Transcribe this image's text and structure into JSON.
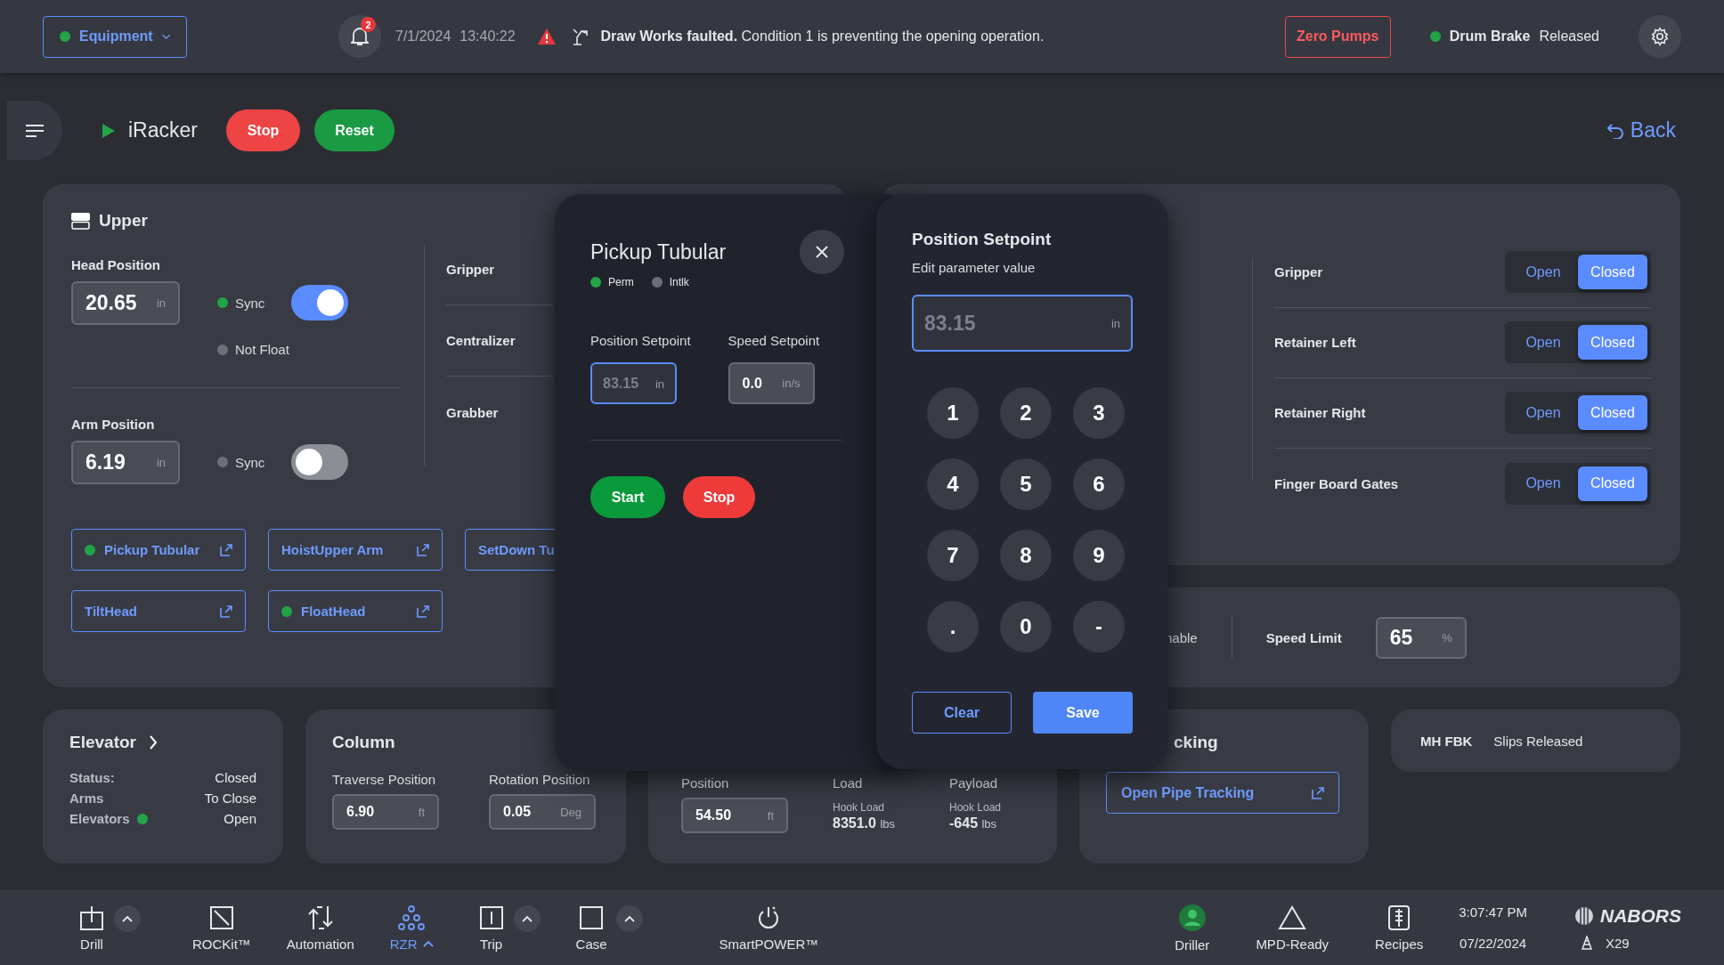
{
  "top_bar": {
    "equipment": {
      "label": "Equipment",
      "active": true
    },
    "notifications": "2",
    "date": "7/1/2024",
    "time": "13:40:22",
    "alert": "**Draw Works faulted.** Condition 1 is preventing the opening operation.",
    "zero_pumps": "Zero Pumps",
    "drum_brake": {
      "label": "Drum Brake",
      "value": "Released",
      "active": true
    }
  },
  "header": {
    "title": "iRacker",
    "running": true,
    "buttons": [
      {
        "label": "Stop",
        "kind": "danger"
      },
      {
        "label": "Reset",
        "kind": "success"
      }
    ],
    "back": "Back"
  },
  "upper": {
    "title": "Upper",
    "positions": [
      {
        "label": "Head Position",
        "value": "20.65",
        "unit": "in",
        "sync": {
          "label": "Sync",
          "active": true,
          "on": true
        },
        "float": {
          "label": "Not Float",
          "active": false
        }
      },
      {
        "label": "Arm Position",
        "value": "6.19",
        "unit": "in",
        "sync": {
          "label": "Sync",
          "active": false,
          "on": false
        }
      }
    ],
    "devices": [
      "Gripper",
      "Centralizer",
      "Grabber"
    ],
    "functions": [
      {
        "label": "Pickup Tubular",
        "active": true
      },
      {
        "label": "HoistUpper Arm",
        "active": false
      },
      {
        "label": "SetDown Tu",
        "active": false
      },
      {
        "label": "TiltHead",
        "active": false
      },
      {
        "label": "FloatHead",
        "active": true
      }
    ]
  },
  "clamps": [
    {
      "label": "Gripper",
      "options": [
        {
          "label": "Open",
          "selected": false
        },
        {
          "label": "Closed",
          "selected": true
        }
      ]
    },
    {
      "label": "Retainer Left",
      "options": [
        {
          "label": "Open",
          "selected": false
        },
        {
          "label": "Closed",
          "selected": true
        }
      ]
    },
    {
      "label": "Retainer Right",
      "options": [
        {
          "label": "Open",
          "selected": false
        },
        {
          "label": "Closed",
          "selected": true
        }
      ]
    },
    {
      "label": "Finger Board Gates",
      "options": [
        {
          "label": "Open",
          "selected": false
        },
        {
          "label": "Closed",
          "selected": true
        }
      ]
    }
  ],
  "limits": {
    "enable": "nable",
    "speed_limit": {
      "label": "Speed Limit",
      "value": "65",
      "unit": "%"
    }
  },
  "elevator": {
    "title": "Elevator",
    "rows": [
      {
        "label": "Status:",
        "value": "Closed",
        "active": false
      },
      {
        "label": "Arms",
        "value": "To Close",
        "active": false
      },
      {
        "label": "Elevators",
        "value": "Open",
        "active": true
      }
    ]
  },
  "column": {
    "title": "Column",
    "fields": [
      {
        "label": "Traverse Position",
        "value": "6.90",
        "unit": "ft"
      },
      {
        "label": "Rotation Position",
        "value": "0.05",
        "unit": "Deg"
      }
    ]
  },
  "racker": {
    "position": {
      "label": "Position",
      "value": "54.50",
      "unit": "ft"
    },
    "readings": [
      {
        "label": "Load",
        "caption": "Hook Load",
        "value": "8351.0",
        "unit": "lbs"
      },
      {
        "label": "Payload",
        "caption": "Hook Load",
        "value": "-645",
        "unit": "lbs"
      }
    ]
  },
  "pipe_tracking": {
    "title": "cking",
    "button": "Open Pipe Tracking"
  },
  "mh_fbk": {
    "label": "MH FBK",
    "value": "Slips Released"
  },
  "pickup_dialog": {
    "title": "Pickup Tubular",
    "indicators": [
      {
        "label": "Perm",
        "active": true
      },
      {
        "label": "Intlk",
        "active": false
      }
    ],
    "fields": [
      {
        "label": "Position Setpoint",
        "placeholder": "83.15",
        "unit": "in",
        "focused": true
      },
      {
        "label": "Speed Setpoint",
        "value": "0.0",
        "unit": "in/s",
        "focused": false
      }
    ],
    "buttons": [
      {
        "label": "Start",
        "kind": "success"
      },
      {
        "label": "Stop",
        "kind": "danger"
      }
    ]
  },
  "keypad": {
    "title": "Position Setpoint",
    "subtitle": "Edit parameter value",
    "field": {
      "placeholder": "83.15",
      "unit": "in",
      "focused": true
    },
    "keys": [
      "1",
      "2",
      "3",
      "4",
      "5",
      "6",
      "7",
      "8",
      "9",
      ".",
      "0",
      "-"
    ],
    "buttons": [
      {
        "label": "Clear",
        "kind": "outline"
      },
      {
        "label": "Save",
        "kind": "primary"
      }
    ]
  },
  "bottom_nav": {
    "items": [
      {
        "label": "Drill",
        "kind": "drill",
        "expandable": true,
        "selected": false
      },
      {
        "label": "ROCKit™",
        "kind": "rockit",
        "expandable": false,
        "selected": false
      },
      {
        "label": "Automation",
        "kind": "automation",
        "expandable": false,
        "selected": false
      },
      {
        "label": "RZR",
        "kind": "rzr",
        "expandable": true,
        "selected": true
      },
      {
        "label": "Trip",
        "kind": "trip",
        "expandable": true,
        "selected": false
      },
      {
        "label": "Case",
        "kind": "case",
        "expandable": true,
        "selected": false
      },
      {
        "label": "SmartPOWER™",
        "kind": "power",
        "expandable": false,
        "selected": false
      }
    ],
    "status": [
      {
        "label": "Driller",
        "kind": "driller"
      },
      {
        "label": "MPD-Ready",
        "kind": "triangle"
      },
      {
        "label": "Recipes",
        "kind": "recipes"
      }
    ],
    "time": "3:07:47 PM",
    "date": "07/22/2024",
    "brand": "NABORS",
    "rig": "X29"
  }
}
